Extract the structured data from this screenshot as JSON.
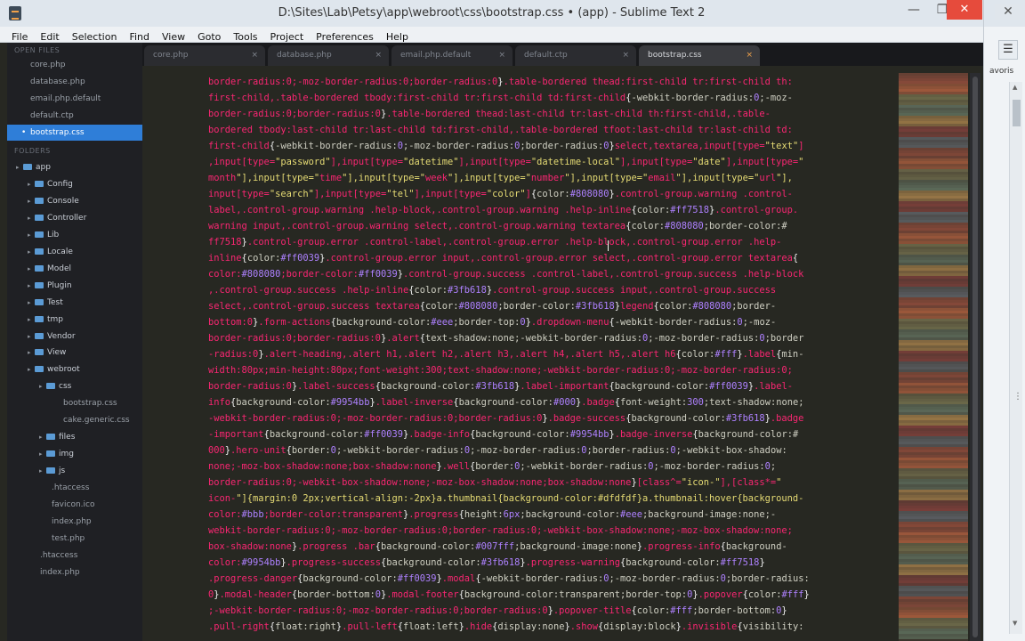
{
  "window": {
    "title": "D:\\Sites\\Lab\\Petsy\\app\\webroot\\css\\bootstrap.css • (app) - Sublime Text 2",
    "controls": {
      "minimize": "—",
      "maximize": "❐",
      "close": "✕"
    }
  },
  "menu": [
    "File",
    "Edit",
    "Selection",
    "Find",
    "View",
    "Goto",
    "Tools",
    "Project",
    "Preferences",
    "Help"
  ],
  "sidebar": {
    "open_files_header": "OPEN FILES",
    "folders_header": "FOLDERS",
    "open_files": [
      {
        "label": "core.php",
        "active": false
      },
      {
        "label": "database.php",
        "active": false
      },
      {
        "label": "email.php.default",
        "active": false
      },
      {
        "label": "default.ctp",
        "active": false
      },
      {
        "label": "bootstrap.css",
        "active": true
      }
    ],
    "tree": [
      {
        "label": "app",
        "depth": 0,
        "type": "folder"
      },
      {
        "label": "Config",
        "depth": 1,
        "type": "folder"
      },
      {
        "label": "Console",
        "depth": 1,
        "type": "folder"
      },
      {
        "label": "Controller",
        "depth": 1,
        "type": "folder"
      },
      {
        "label": "Lib",
        "depth": 1,
        "type": "folder"
      },
      {
        "label": "Locale",
        "depth": 1,
        "type": "folder"
      },
      {
        "label": "Model",
        "depth": 1,
        "type": "folder"
      },
      {
        "label": "Plugin",
        "depth": 1,
        "type": "folder"
      },
      {
        "label": "Test",
        "depth": 1,
        "type": "folder"
      },
      {
        "label": "tmp",
        "depth": 1,
        "type": "folder"
      },
      {
        "label": "Vendor",
        "depth": 1,
        "type": "folder"
      },
      {
        "label": "View",
        "depth": 1,
        "type": "folder"
      },
      {
        "label": "webroot",
        "depth": 1,
        "type": "folder"
      },
      {
        "label": "css",
        "depth": 2,
        "type": "folder"
      },
      {
        "label": "bootstrap.css",
        "depth": 3,
        "type": "file"
      },
      {
        "label": "cake.generic.css",
        "depth": 3,
        "type": "file"
      },
      {
        "label": "files",
        "depth": 2,
        "type": "folder"
      },
      {
        "label": "img",
        "depth": 2,
        "type": "folder"
      },
      {
        "label": "js",
        "depth": 2,
        "type": "folder"
      },
      {
        "label": ".htaccess",
        "depth": 2,
        "type": "file"
      },
      {
        "label": "favicon.ico",
        "depth": 2,
        "type": "file"
      },
      {
        "label": "index.php",
        "depth": 2,
        "type": "file"
      },
      {
        "label": "test.php",
        "depth": 2,
        "type": "file"
      },
      {
        "label": ".htaccess",
        "depth": 1,
        "type": "file"
      },
      {
        "label": "index.php",
        "depth": 1,
        "type": "file"
      }
    ]
  },
  "tabs": [
    {
      "label": "core.php",
      "active": false
    },
    {
      "label": "database.php",
      "active": false
    },
    {
      "label": "email.php.default",
      "active": false
    },
    {
      "label": "default.ctp",
      "active": false
    },
    {
      "label": "bootstrap.css",
      "active": true
    }
  ],
  "tab_close_glyph": "×",
  "code_lines": [
    "border-radius:0;-moz-border-radius:0;border-radius:0}.table-bordered thead:first-child tr:first-child th:",
    "first-child,.table-bordered tbody:first-child tr:first-child td:first-child{-webkit-border-radius:0;-moz-",
    "border-radius:0;border-radius:0}.table-bordered thead:last-child tr:last-child th:first-child,.table-",
    "bordered tbody:last-child tr:last-child td:first-child,.table-bordered tfoot:last-child tr:last-child td:",
    "first-child{-webkit-border-radius:0;-moz-border-radius:0;border-radius:0}select,textarea,input[type=\"text\"]",
    ",input[type=\"password\"],input[type=\"datetime\"],input[type=\"datetime-local\"],input[type=\"date\"],input[type=\"",
    "month\"],input[type=\"time\"],input[type=\"week\"],input[type=\"number\"],input[type=\"email\"],input[type=\"url\"],",
    "input[type=\"search\"],input[type=\"tel\"],input[type=\"color\"]{color:#808080}.control-group.warning .control-",
    "label,.control-group.warning .help-block,.control-group.warning .help-inline{color:#ff7518}.control-group.",
    "warning input,.control-group.warning select,.control-group.warning textarea{color:#808080;border-color:#",
    "ff7518}.control-group.error .control-label,.control-group.error .help-block,.control-group.error .help-",
    "inline{color:#ff0039}.control-group.error input,.control-group.error select,.control-group.error textarea{",
    "color:#808080;border-color:#ff0039}.control-group.success .control-label,.control-group.success .help-block",
    ",.control-group.success .help-inline{color:#3fb618}.control-group.success input,.control-group.success",
    "select,.control-group.success textarea{color:#808080;border-color:#3fb618}legend{color:#808080;border-",
    "bottom:0}.form-actions{background-color:#eee;border-top:0}.dropdown-menu{-webkit-border-radius:0;-moz-",
    "border-radius:0;border-radius:0}.alert{text-shadow:none;-webkit-border-radius:0;-moz-border-radius:0;border",
    "-radius:0}.alert-heading,.alert h1,.alert h2,.alert h3,.alert h4,.alert h5,.alert h6{color:#fff}.label{min-",
    "width:80px;min-height:80px;font-weight:300;text-shadow:none;-webkit-border-radius:0;-moz-border-radius:0;",
    "border-radius:0}.label-success{background-color:#3fb618}.label-important{background-color:#ff0039}.label-",
    "info{background-color:#9954bb}.label-inverse{background-color:#000}.badge{font-weight:300;text-shadow:none;",
    "-webkit-border-radius:0;-moz-border-radius:0;border-radius:0}.badge-success{background-color:#3fb618}.badge",
    "-important{background-color:#ff0039}.badge-info{background-color:#9954bb}.badge-inverse{background-color:#",
    "000}.hero-unit{border:0;-webkit-border-radius:0;-moz-border-radius:0;border-radius:0;-webkit-box-shadow:",
    "none;-moz-box-shadow:none;box-shadow:none}.well{border:0;-webkit-border-radius:0;-moz-border-radius:0;",
    "border-radius:0;-webkit-box-shadow:none;-moz-box-shadow:none;box-shadow:none}[class^=\"icon-\"],[class*=\"",
    "icon-\"]{margin:0 2px;vertical-align:-2px}a.thumbnail{background-color:#dfdfdf}a.thumbnail:hover{background-",
    "color:#bbb;border-color:transparent}.progress{height:6px;background-color:#eee;background-image:none;-",
    "webkit-border-radius:0;-moz-border-radius:0;border-radius:0;-webkit-box-shadow:none;-moz-box-shadow:none;",
    "box-shadow:none}.progress .bar{background-color:#007fff;background-image:none}.progress-info{background-",
    "color:#9954bb}.progress-success{background-color:#3fb618}.progress-warning{background-color:#ff7518}",
    ".progress-danger{background-color:#ff0039}.modal{-webkit-border-radius:0;-moz-border-radius:0;border-radius:",
    "0}.modal-header{border-bottom:0}.modal-footer{background-color:transparent;border-top:0}.popover{color:#fff}",
    ";-webkit-border-radius:0;-moz-border-radius:0;border-radius:0}.popover-title{color:#fff;border-bottom:0}",
    ".pull-right{float:right}.pull-left{float:left}.hide{display:none}.show{display:block}.invisible{visibility:"
  ],
  "right_panel": {
    "close_glyph": "✕",
    "menu_glyph": "☰",
    "label": "avoris",
    "scroll_up": "▲",
    "scroll_down": "▼",
    "mid_mark": "⋮"
  },
  "colors": {
    "selector": "#f92672",
    "string": "#e6db74",
    "number": "#ae81ff",
    "accent": "#2f7ed8",
    "close": "#e64b3c"
  }
}
